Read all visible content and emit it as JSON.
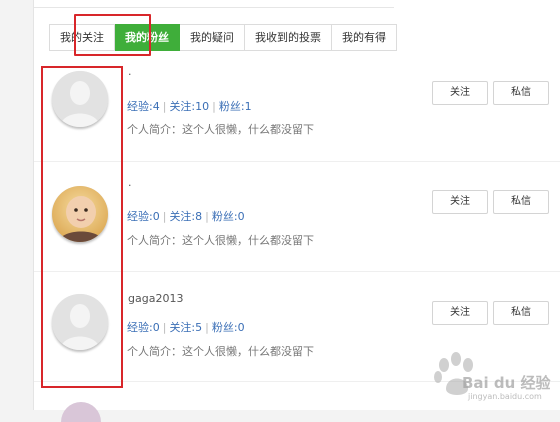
{
  "tabs": [
    {
      "label": "我的关注",
      "active": false
    },
    {
      "label": "我的粉丝",
      "active": true
    },
    {
      "label": "我的疑问",
      "active": false
    },
    {
      "label": "我收到的投票",
      "active": false
    },
    {
      "label": "我的有得",
      "active": false
    }
  ],
  "followers": [
    {
      "name": ".",
      "exp_label": "经验:",
      "exp": "4",
      "follow_label": "关注:",
      "follow": "10",
      "fans_label": "粉丝:",
      "fans": "1",
      "bio": "个人简介：这个人很懒，什么都没留下",
      "avatar": "default-avatar"
    },
    {
      "name": ".",
      "exp_label": "经验:",
      "exp": "0",
      "follow_label": "关注:",
      "follow": "8",
      "fans_label": "粉丝:",
      "fans": "0",
      "bio": "个人简介：这个人很懒，什么都没留下",
      "avatar": "baby-photo-avatar"
    },
    {
      "name": "gaga2013",
      "exp_label": "经验:",
      "exp": "0",
      "follow_label": "关注:",
      "follow": "5",
      "fans_label": "粉丝:",
      "fans": "0",
      "bio": "个人简介：这个人很懒，什么都没留下",
      "avatar": "default-avatar"
    }
  ],
  "buttons": {
    "follow": "关注",
    "message": "私信"
  },
  "watermark": {
    "text": "Bai du 经验",
    "sub": "jingyan.baidu.com"
  },
  "colors": {
    "active_tab": "#3fae3a",
    "highlight": "#d8262a",
    "stats": "#3b6fb6"
  }
}
